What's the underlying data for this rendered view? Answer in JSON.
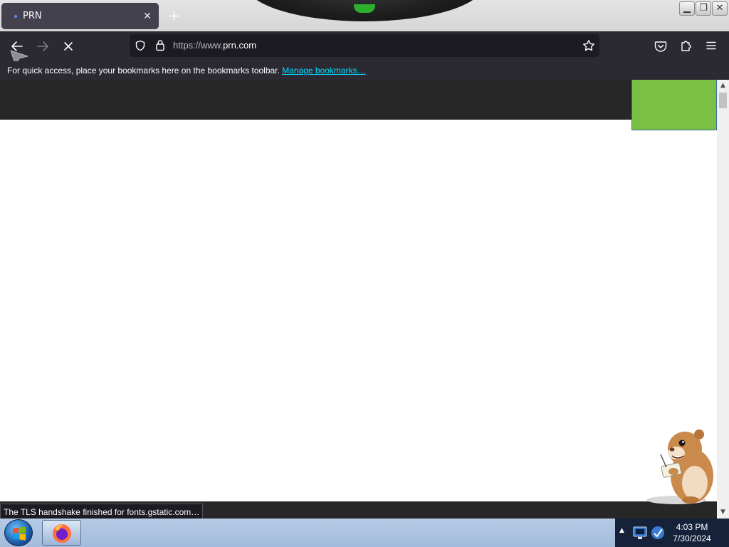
{
  "browser": {
    "tab": {
      "title": "PRN"
    },
    "url": {
      "prefix": "https://www.",
      "domain": "prn.com"
    },
    "bookmarks_bar": {
      "message": "For quick access, place your bookmarks here on the bookmarks toolbar.",
      "link": "Manage bookmarks…"
    },
    "status_text": "The TLS handshake finished for fonts.gstatic.com…"
  },
  "taskbar": {
    "time": "4:03 PM",
    "date": "7/30/2024"
  },
  "colors": {
    "site_header": "#272727",
    "site_green": "#7ac143",
    "toolbar": "#2b2a33",
    "link": "#00ddff"
  }
}
